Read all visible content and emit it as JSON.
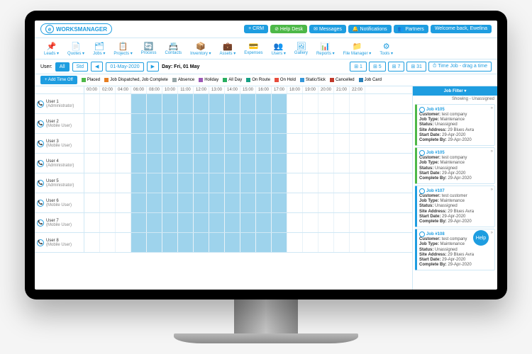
{
  "logo": {
    "mark": "e",
    "text": "WORKSMANAGER"
  },
  "topbar": [
    {
      "label": "+ CRM",
      "cls": ""
    },
    {
      "label": "⊘ Help Desk",
      "cls": "green"
    },
    {
      "label": "✉ Messages",
      "cls": ""
    },
    {
      "label": "🔔 Notifications",
      "cls": ""
    },
    {
      "label": "👥 Partners",
      "cls": ""
    },
    {
      "label": "Welcome back, Ewelina",
      "cls": ""
    }
  ],
  "menu": [
    {
      "icon": "📌",
      "label": "Leads ▾"
    },
    {
      "icon": "📄",
      "label": "Quotes ▾"
    },
    {
      "icon": "🗂",
      "label": "Jobs ▾"
    },
    {
      "icon": "📋",
      "label": "Projects ▾"
    },
    {
      "icon": "🔄",
      "label": "Process"
    },
    {
      "icon": "📇",
      "label": "Contacts"
    },
    {
      "icon": "📦",
      "label": "Inventory ▾"
    },
    {
      "icon": "💼",
      "label": "Assets ▾"
    },
    {
      "icon": "💳",
      "label": "Expenses"
    },
    {
      "icon": "👥",
      "label": "Users ▾"
    },
    {
      "icon": "🖼",
      "label": "Gallery"
    },
    {
      "icon": "📊",
      "label": "Reports ▾"
    },
    {
      "icon": "📁",
      "label": "File Manager ▾"
    },
    {
      "icon": "⚙",
      "label": "Tools ▾"
    }
  ],
  "ctrl": {
    "user_label": "User:",
    "all": "All",
    "std": "Std",
    "date_nav_prev": "◀",
    "date_val": "01-May-2020",
    "date_nav_next": "▶",
    "day_label": "Day: Fri, 01 May",
    "add_btn": "+ Add Time Off",
    "right_btns": [
      "⊞ 1",
      "⊞ 5",
      "⊞ 7",
      "⊞ 31"
    ],
    "time_job": "⏱ Time Job - drag a time"
  },
  "legend": [
    {
      "c": "#4db848",
      "t": "Placed"
    },
    {
      "c": "#e67e22",
      "t": "Job Dispatched, Job Complete"
    },
    {
      "c": "#95a5a6",
      "t": "Absence"
    },
    {
      "c": "#9b59b6",
      "t": "Holiday"
    },
    {
      "c": "#27ae60",
      "t": "All Day"
    },
    {
      "c": "#16a085",
      "t": "On Route"
    },
    {
      "c": "#e74c3c",
      "t": "On Hold"
    },
    {
      "c": "#3498db",
      "t": "Static/Sick"
    },
    {
      "c": "#c0392b",
      "t": "Cancelled"
    },
    {
      "c": "#2980b9",
      "t": "Job Card"
    }
  ],
  "hours": [
    "00:00",
    "02:00",
    "04:00",
    "06:00",
    "08:00",
    "10:00",
    "11:00",
    "12:00",
    "13:00",
    "14:00",
    "15:00",
    "16:00",
    "17:00",
    "18:00",
    "19:00",
    "20:00",
    "21:00",
    "22:00"
  ],
  "users": [
    {
      "name": "User 1",
      "role": "(Administrator)"
    },
    {
      "name": "User 2",
      "role": "(Mobile User)"
    },
    {
      "name": "User 3",
      "role": "(Mobile User)"
    },
    {
      "name": "User 4",
      "role": "(Administrator)"
    },
    {
      "name": "User 5",
      "role": "(Administrator)"
    },
    {
      "name": "User 6",
      "role": "(Mobile User)"
    },
    {
      "name": "User 7",
      "role": "(Mobile User)"
    },
    {
      "name": "User 8",
      "role": "(Mobile User)"
    }
  ],
  "sidebar": {
    "head": "Job Filter ▾",
    "sub": "Showing - Unassigned",
    "jobs": [
      {
        "id": "Job #105",
        "cust": "test company",
        "type": "Maintenance",
        "status": "Unassigned",
        "addr": "29 Blues Avra",
        "start": "29-Apr-2020",
        "complete": "29-Apr-2020",
        "cls": "a"
      },
      {
        "id": "Job #105",
        "cust": "test company",
        "type": "Maintenance",
        "status": "Unassigned",
        "addr": "",
        "start": "29-Apr-2020",
        "complete": "29-Apr-2020",
        "cls": "a"
      },
      {
        "id": "Job #107",
        "cust": "test customer",
        "type": "Maintenance",
        "status": "Unassigned",
        "addr": "29 Blues Avra",
        "start": "29-Apr-2020",
        "complete": "29-Apr-2020",
        "cls": "b"
      },
      {
        "id": "Job #108",
        "cust": "test company",
        "type": "Maintenance",
        "status": "Unassigned",
        "addr": "29 Blues Avra",
        "start": "29-Apr-2020",
        "complete": "29-Apr-2020",
        "cls": "b"
      }
    ],
    "labels": {
      "cust": "Customer:",
      "type": "Job Type:",
      "status": "Status:",
      "addr": "Site Address:",
      "start": "Start Date:",
      "complete": "Complete By:"
    }
  },
  "help": "Help"
}
